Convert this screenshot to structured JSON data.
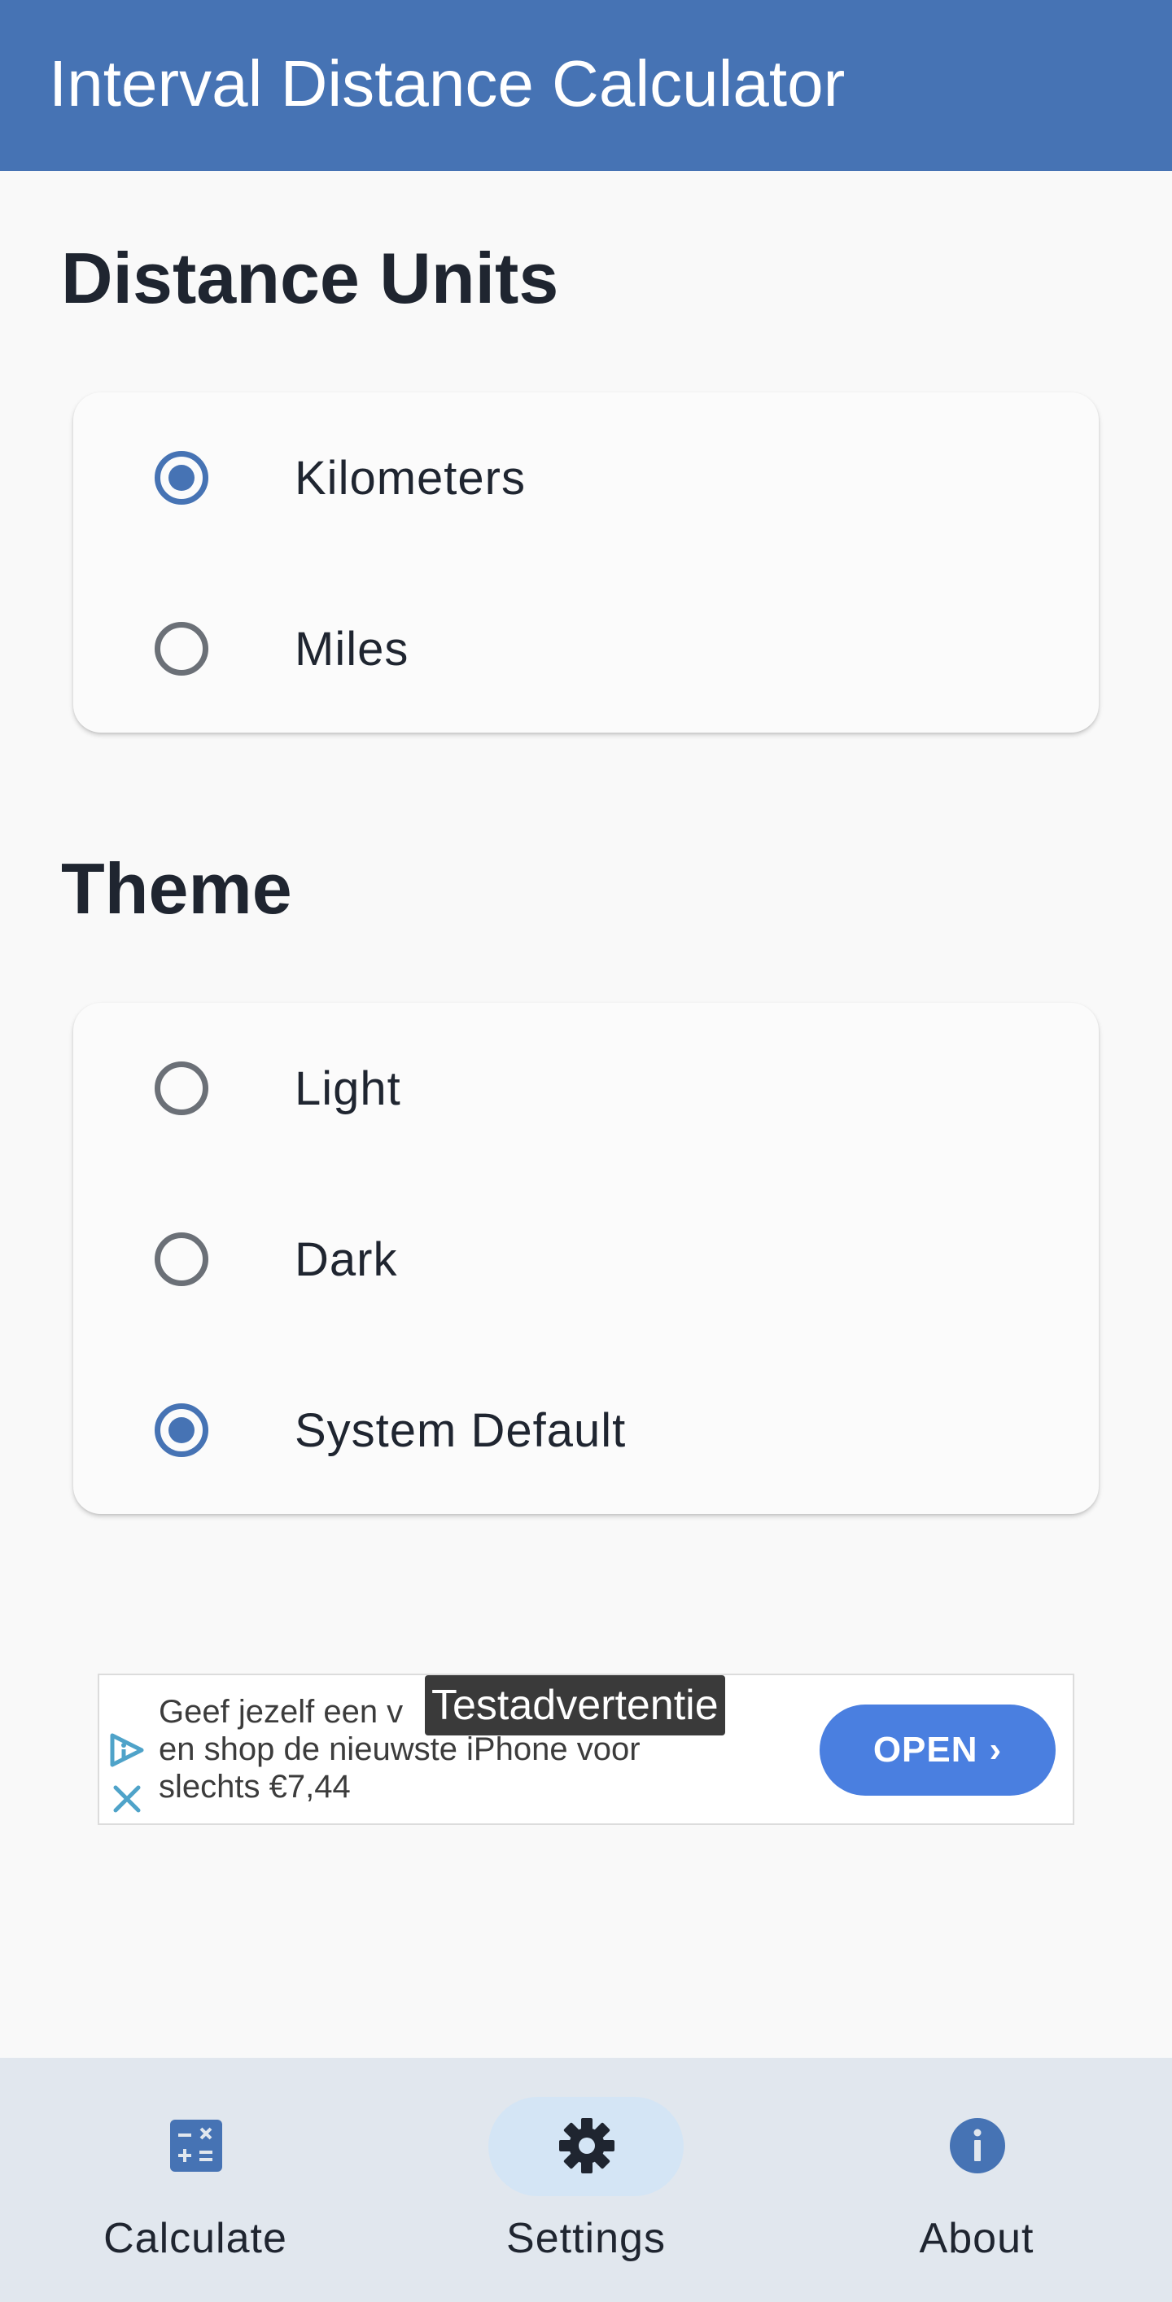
{
  "appbar": {
    "title": "Interval Distance Calculator"
  },
  "distance_units": {
    "title": "Distance Units",
    "options": [
      {
        "label": "Kilometers",
        "selected": true
      },
      {
        "label": "Miles",
        "selected": false
      }
    ]
  },
  "theme": {
    "title": "Theme",
    "options": [
      {
        "label": "Light",
        "selected": false
      },
      {
        "label": "Dark",
        "selected": false
      },
      {
        "label": "System Default",
        "selected": true
      }
    ]
  },
  "ad": {
    "tag": "Testadvertentie",
    "line1": "Geef jezelf een v",
    "line2": "en shop de nieuwste iPhone voor",
    "line3": "slechts €7,44",
    "button": "OPEN"
  },
  "bottom_nav": {
    "items": [
      {
        "label": "Calculate",
        "icon": "calculator-icon",
        "active": false
      },
      {
        "label": "Settings",
        "icon": "gear-icon",
        "active": true
      },
      {
        "label": "About",
        "icon": "info-icon",
        "active": false
      }
    ]
  },
  "colors": {
    "primary": "#4673b4",
    "background": "#f9f9f9",
    "nav_background": "#e1e7ee",
    "ad_button": "#4a7fe0"
  }
}
